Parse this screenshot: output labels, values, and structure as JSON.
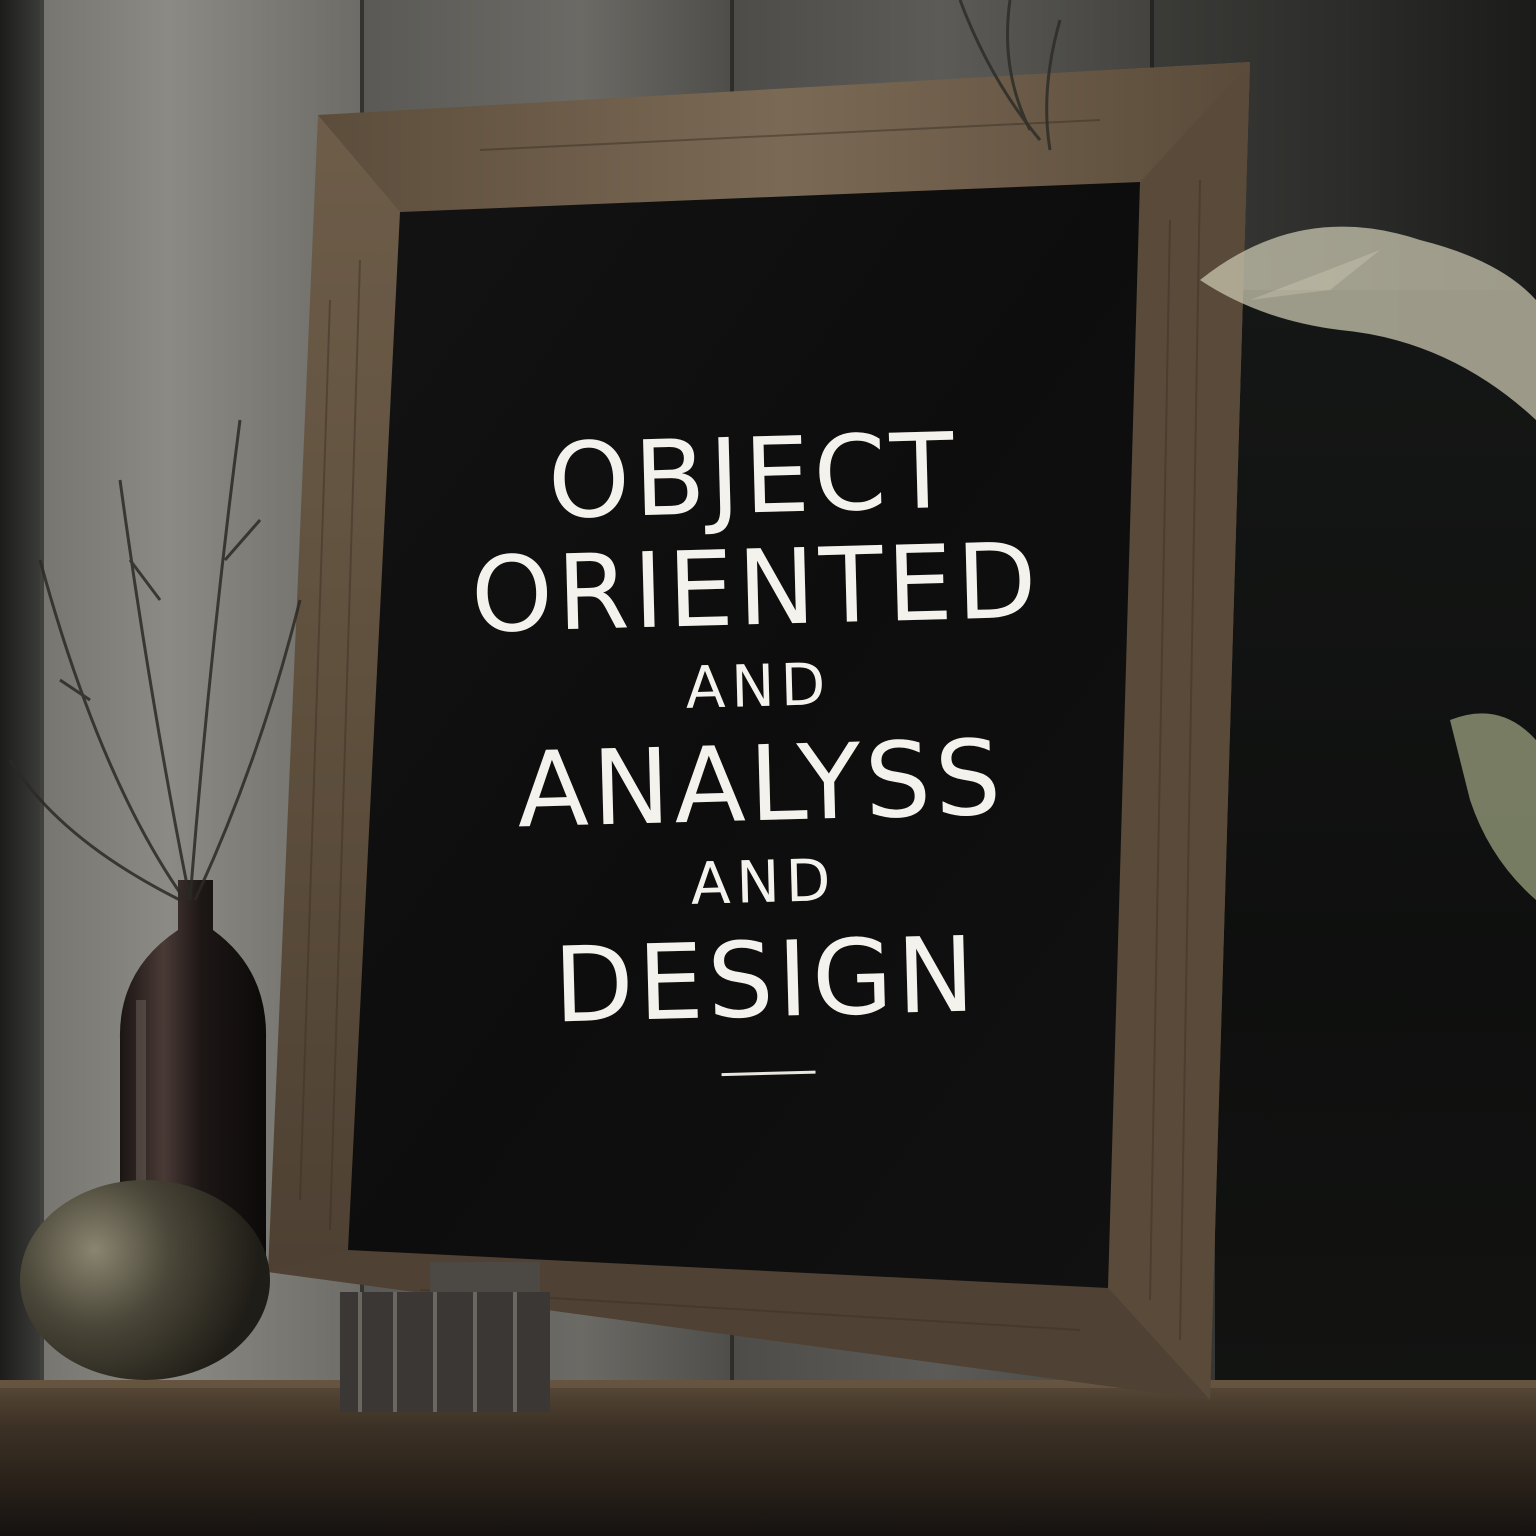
{
  "poster": {
    "line1": "OBJECT",
    "line2": "ORIENTED",
    "line3": "AND",
    "line4": "ANALYSS",
    "line5": "AND",
    "line6": "DESIGN"
  },
  "colors": {
    "poster_background": "#0f0f0f",
    "poster_text": "#f4f2ec",
    "frame_wood": "#6b5a45"
  }
}
